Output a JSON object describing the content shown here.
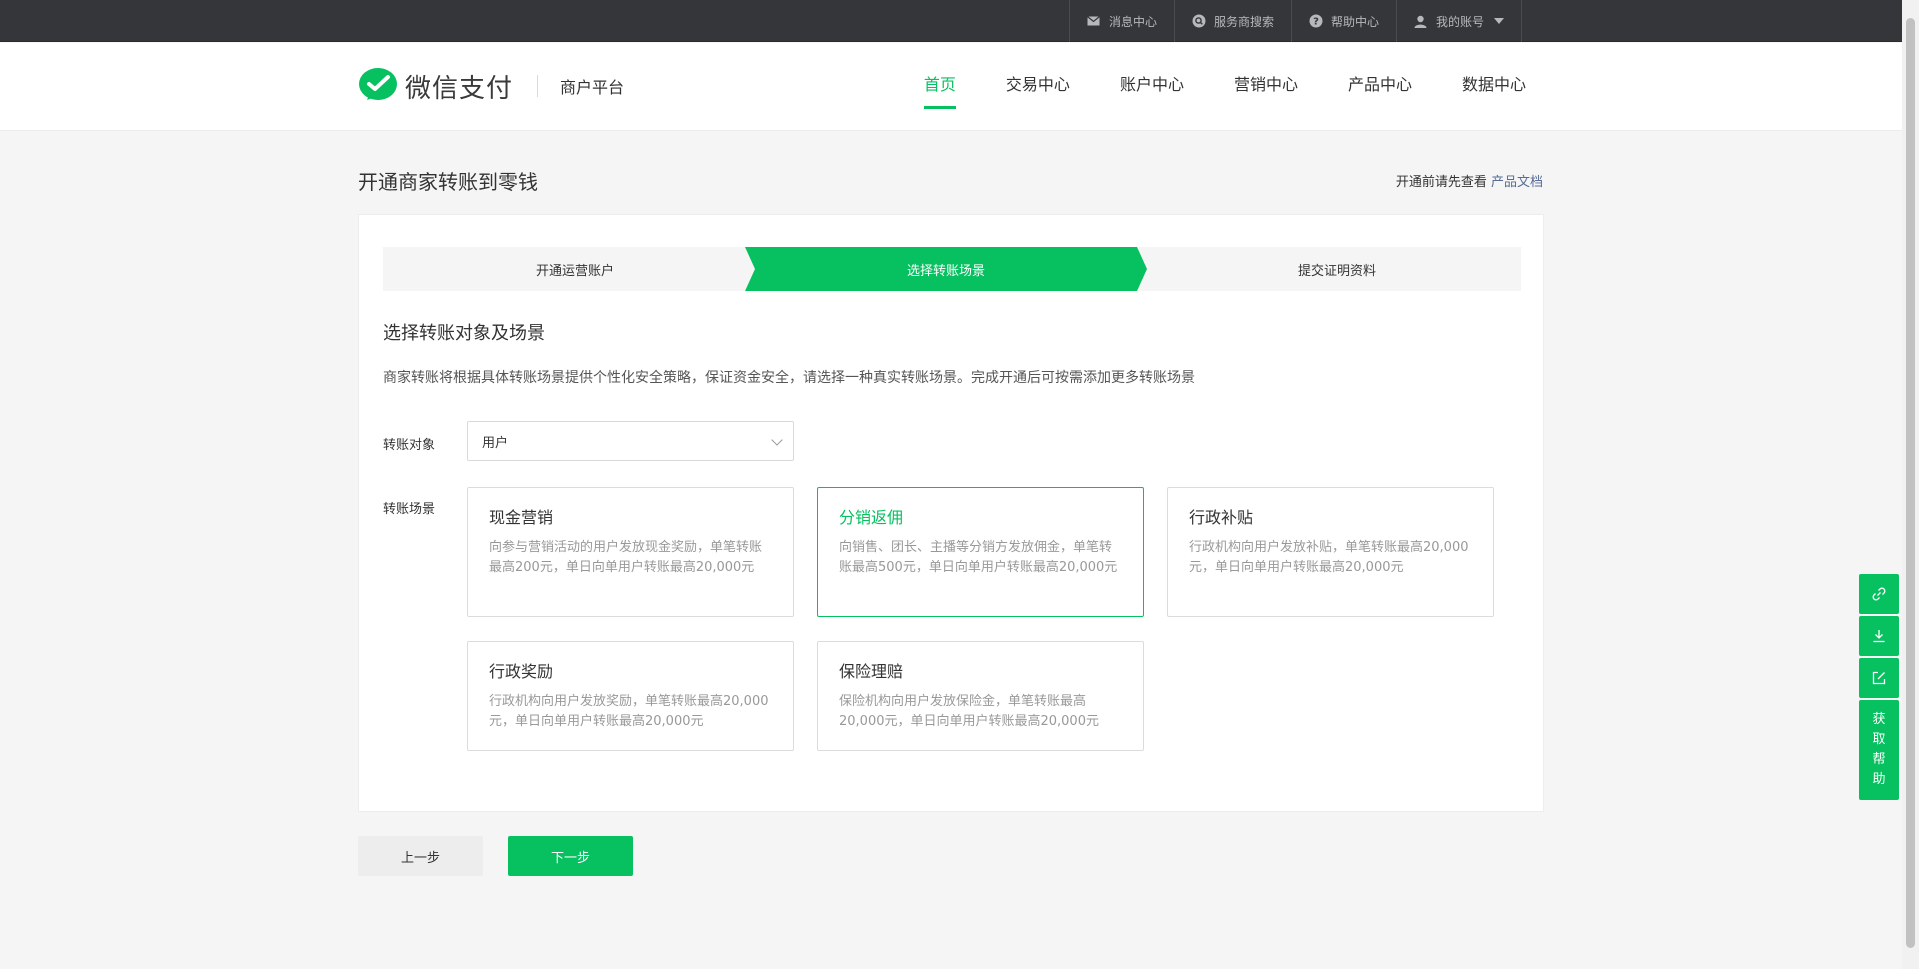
{
  "topbar": {
    "items": [
      {
        "label": "消息中心",
        "icon": "mail-icon"
      },
      {
        "label": "服务商搜索",
        "icon": "search-circle-icon"
      },
      {
        "label": "帮助中心",
        "icon": "help-icon"
      },
      {
        "label": "我的账号",
        "icon": "user-icon"
      }
    ]
  },
  "header": {
    "brand": "微信支付",
    "sub": "商户平台",
    "nav": [
      "首页",
      "交易中心",
      "账户中心",
      "营销中心",
      "产品中心",
      "数据中心"
    ],
    "active_nav": "首页"
  },
  "page": {
    "title": "开通商家转账到零钱",
    "doc_tip": "开通前请先查看",
    "doc_link": "产品文档"
  },
  "steps": [
    "开通运营账户",
    "选择转账场景",
    "提交证明资料"
  ],
  "active_step": 2,
  "section": {
    "title": "选择转账对象及场景",
    "desc": "商家转账将根据具体转账场景提供个性化安全策略，保证资金安全，请选择一种真实转账场景。完成开通后可按需添加更多转账场景"
  },
  "form": {
    "target_label": "转账对象",
    "target_value": "用户",
    "scene_label": "转账场景"
  },
  "scenes": [
    {
      "title": "现金营销",
      "desc": "向参与营销活动的用户发放现金奖励，单笔转账最高200元，单日向单用户转账最高20,000元"
    },
    {
      "title": "分销返佣",
      "desc": "向销售、团长、主播等分销方发放佣金，单笔转账最高500元，单日向单用户转账最高20,000元"
    },
    {
      "title": "行政补贴",
      "desc": "行政机构向用户发放补贴，单笔转账最高20,000元，单日向单用户转账最高20,000元"
    },
    {
      "title": "行政奖励",
      "desc": "行政机构向用户发放奖励，单笔转账最高20,000元，单日向单用户转账最高20,000元"
    },
    {
      "title": "保险理赔",
      "desc": "保险机构向用户发放保险金，单笔转账最高20,000元，单日向单用户转账最高20,000元"
    }
  ],
  "selected_scene": "分销返佣",
  "buttons": {
    "prev": "上一步",
    "next": "下一步"
  },
  "side_tools": {
    "icons": [
      "link-icon",
      "download-icon",
      "edit-icon"
    ],
    "help": [
      "获",
      "取",
      "帮",
      "助"
    ]
  },
  "colors": {
    "accent": "#07c160",
    "topbar": "#35363a",
    "link": "#576b95"
  }
}
